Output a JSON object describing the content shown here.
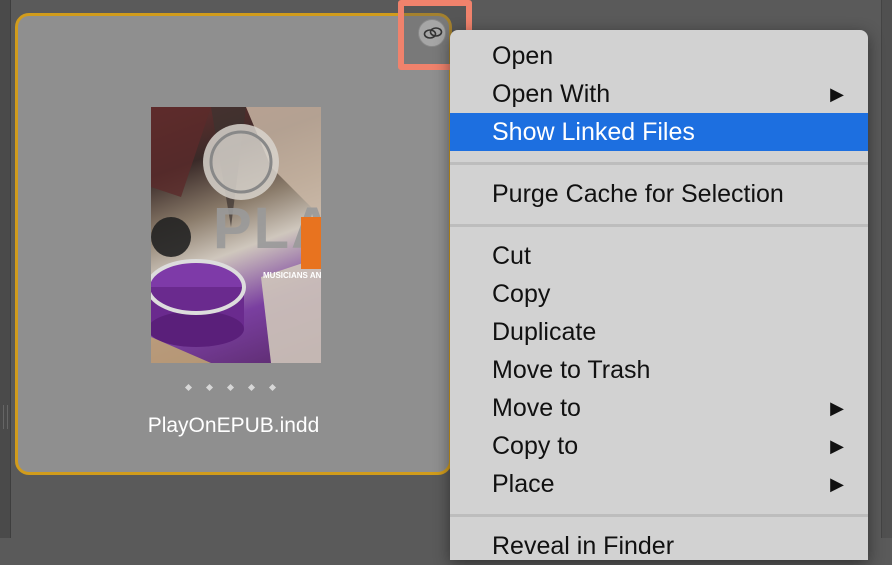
{
  "file": {
    "name": "PlayOnEPUB.indd",
    "cover_text": {
      "title": "PLAY",
      "subtitle": "MUSICIANS AND TH"
    }
  },
  "link_badge": {
    "icon": "linked-files-icon"
  },
  "context_menu": {
    "items": [
      {
        "label": "Open",
        "submenu": false,
        "selected": false
      },
      {
        "label": "Open With",
        "submenu": true,
        "selected": false
      },
      {
        "label": "Show Linked Files",
        "submenu": false,
        "selected": true
      },
      {
        "label": "Purge Cache for Selection",
        "submenu": false,
        "selected": false
      },
      {
        "label": "Cut",
        "submenu": false,
        "selected": false
      },
      {
        "label": "Copy",
        "submenu": false,
        "selected": false
      },
      {
        "label": "Duplicate",
        "submenu": false,
        "selected": false
      },
      {
        "label": "Move to Trash",
        "submenu": false,
        "selected": false
      },
      {
        "label": "Move to",
        "submenu": true,
        "selected": false
      },
      {
        "label": "Copy to",
        "submenu": true,
        "selected": false
      },
      {
        "label": "Place",
        "submenu": true,
        "selected": false
      },
      {
        "label": "Reveal in Finder",
        "submenu": false,
        "selected": false
      }
    ],
    "submenu_glyph": "▶"
  },
  "colors": {
    "selection": "#1d6fe0",
    "card_border": "#d19c1c",
    "highlight_box": "#f0826c"
  }
}
